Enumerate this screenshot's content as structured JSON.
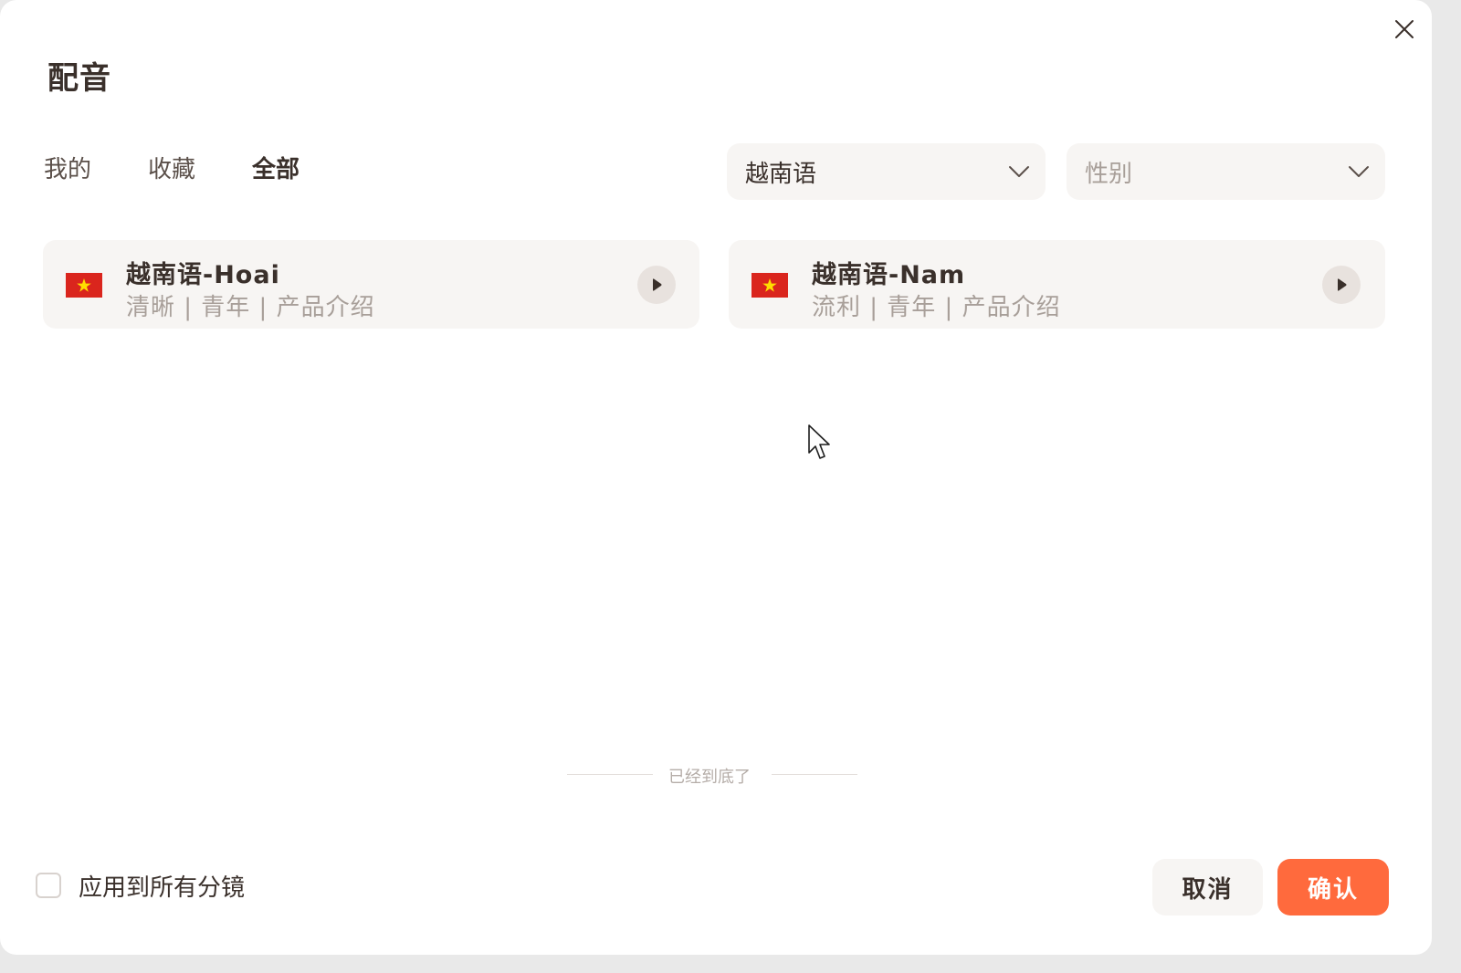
{
  "dialog": {
    "title": "配音"
  },
  "tabs": [
    {
      "label": "我的",
      "active": false
    },
    {
      "label": "收藏",
      "active": false
    },
    {
      "label": "全部",
      "active": true
    }
  ],
  "filters": {
    "language": {
      "value": "越南语"
    },
    "gender": {
      "placeholder": "性别"
    }
  },
  "voices": [
    {
      "name": "越南语-Hoai",
      "tags": "清晰 | 青年 | 产品介绍",
      "flag_icon": "vietnam-flag-icon"
    },
    {
      "name": "越南语-Nam",
      "tags": "流利 | 青年 | 产品介绍",
      "flag_icon": "vietnam-flag-icon"
    }
  ],
  "list_end_text": "已经到底了",
  "footer": {
    "apply_all_label": "应用到所有分镜",
    "apply_all_checked": false,
    "cancel_label": "取消",
    "confirm_label": "确认"
  },
  "colors": {
    "accent": "#ff6a3d",
    "text_primary": "#3a302b",
    "text_secondary": "#a89f99",
    "card_bg": "#f7f5f3",
    "flag_red": "#da251d",
    "flag_star": "#ffdd00"
  }
}
